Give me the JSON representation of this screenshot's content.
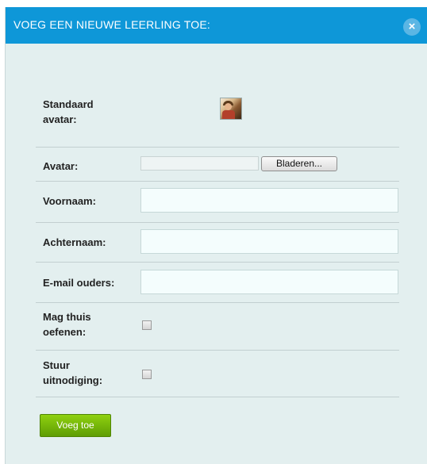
{
  "dialog": {
    "title": "VOEG EEN NIEUWE LEERLING TOE:",
    "close_icon": "close-icon",
    "close_glyph": "×"
  },
  "form": {
    "default_avatar_label": "Standaard avatar:",
    "avatar_label": "Avatar:",
    "file_value": "",
    "browse_label": "Bladeren...",
    "first_name_label": "Voornaam:",
    "first_name_value": "",
    "last_name_label": "Achternaam:",
    "last_name_value": "",
    "parent_email_label": "E-mail ouders:",
    "parent_email_value": "",
    "practice_home_label": "Mag thuis oefenen:",
    "practice_home_checked": false,
    "send_invite_label": "Stuur uitnodiging:",
    "send_invite_checked": false,
    "submit_label": "Voeg toe"
  },
  "colors": {
    "titlebar": "#0e97d8",
    "background": "#e3efef",
    "submit": "#6fb20a"
  }
}
